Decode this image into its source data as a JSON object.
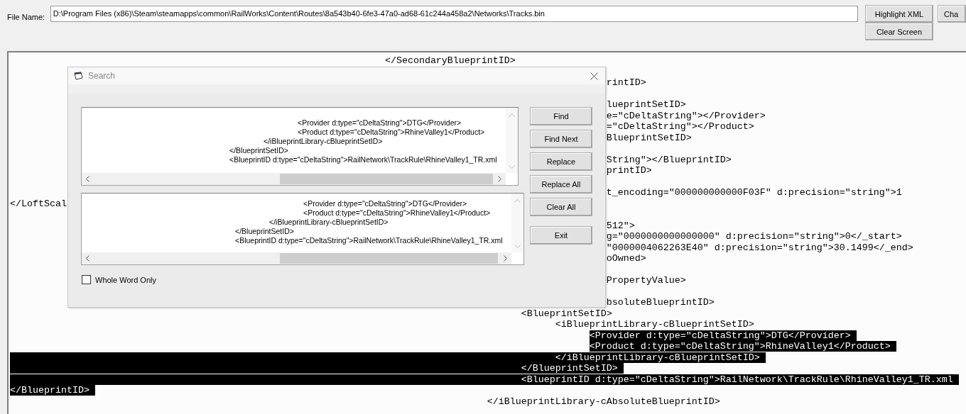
{
  "toolbar": {
    "file_label": "File Name:",
    "file_path": "D:\\Program Files (x86)\\Steam\\steamapps\\common\\RailWorks\\Content\\Routes\\8a543b40-6fe3-47a0-ad68-61c244a458a2\\Networks\\Tracks.bin",
    "buttons": [
      {
        "label": "Highlight XML"
      },
      {
        "label": "Clear Screen"
      }
    ],
    "cut_button": "Cha"
  },
  "editor": {
    "lines": [
      {
        "text": "                                                                  </SecondaryBlueprintID>",
        "selected": false,
        "kind": "inline"
      },
      {
        "selected": false,
        "kind": "inline"
      },
      {
        "text": "                                                                                                         rintID>",
        "selected": false,
        "kind": "inline"
      },
      {
        "selected": false,
        "kind": "inline"
      },
      {
        "text": "                                                                                                         lueprintSetID>",
        "selected": false,
        "kind": "inline"
      },
      {
        "text": "                                                                                                         e=\"cDeltaString\"></Provider>",
        "selected": false,
        "kind": "inline"
      },
      {
        "text": "                                                                                                         =\"cDeltaString\"></Product>",
        "selected": false,
        "kind": "inline"
      },
      {
        "text": "                                                                                                         BlueprintSetID>",
        "selected": false,
        "kind": "inline"
      },
      {
        "selected": false,
        "kind": "inline"
      },
      {
        "text": "                                                                                                         String\"></BlueprintID>",
        "selected": false,
        "kind": "inline"
      },
      {
        "text": "                                                                                                         printID>",
        "selected": false,
        "kind": "inline"
      },
      {
        "selected": false,
        "kind": "inline"
      },
      {
        "text": "                                                                                                         t_encoding=\"000000000000F03F\" d:precision=\"string\">1",
        "selected": false,
        "kind": "inline"
      },
      {
        "text": "</LoftScal",
        "selected": false,
        "kind": "inline"
      },
      {
        "selected": false,
        "kind": "inline"
      },
      {
        "text": "                                                                                                         512\">",
        "selected": false,
        "kind": "inline"
      },
      {
        "text": "                                                                                                         g=\"0000000000000000\" d:precision=\"string\">0</_start>",
        "selected": false,
        "kind": "inline"
      },
      {
        "text": "                                                                                                         \"0000004062263E40\" d:precision=\"string\">30.1499</_end>",
        "selected": false,
        "kind": "inline"
      },
      {
        "text": "                                                                                                         oOwned>",
        "selected": false,
        "kind": "inline"
      },
      {
        "selected": false,
        "kind": "inline"
      },
      {
        "text": "                                                                                                         PropertyValue>",
        "selected": false,
        "kind": "inline"
      },
      {
        "selected": false,
        "kind": "inline"
      },
      {
        "text": "                                                                                                         bsoluteBlueprintID>",
        "selected": false,
        "kind": "inline"
      },
      {
        "text": "                                                                                          <BlueprintSetID>",
        "selected": false,
        "kind": "inline"
      },
      {
        "text": "                                                                                                <iBlueprintLibrary-cBlueprintSetID>",
        "selected": false,
        "kind": "inline"
      },
      {
        "text": "                                                                                                      <Provider d:type=\"cDeltaString\">DTG</Provider>",
        "selected": true,
        "kind": "inline"
      },
      {
        "text": "                                                                                                      <Product d:type=\"cDeltaString\">RhineValley1</Product>",
        "selected": true,
        "kind": "inline"
      },
      {
        "text": "                                                                                                </iBlueprintLibrary-cBlueprintSetID>",
        "selected": true,
        "kind": "full"
      },
      {
        "text": "                                                                                          </BlueprintSetID>",
        "selected": true,
        "kind": "full"
      },
      {
        "text": "                                                                                          <BlueprintID d:type=\"cDeltaString\">RailNetwork\\TrackRule\\RhineValley1_TR.xml",
        "selected": true,
        "kind": "full"
      },
      {
        "text": "</BlueprintID>",
        "selected": true,
        "kind": "full"
      },
      {
        "text": "                                                                                    </iBlueprintLibrary-cAbsoluteBlueprintID>",
        "selected": false,
        "kind": "inline"
      }
    ]
  },
  "search_dialog": {
    "title": "Search",
    "find_box": [
      "\t\t\t\t\t\t<Provider d:type=\"cDeltaString\">DTG</Provider>",
      "\t\t\t\t\t\t<Product d:type=\"cDeltaString\">RhineValley1</Product>",
      "\t\t\t\t\t</iBlueprintLibrary-cBlueprintSetID>",
      "\t\t\t\t</BlueprintSetID>",
      "\t\t\t\t<BlueprintID d:type=\"cDeltaString\">RailNetwork\\TrackRule\\RhineValley1_TR.xml"
    ],
    "replace_box": [
      "\t\t\t\t\t\t<Provider d:type=\"cDeltaString\">DTG</Provider>",
      "\t\t\t\t\t\t<Product d:type=\"cDeltaString\">RhineValley1</Product>",
      "\t\t\t\t\t</iBlueprintLibrary-cBlueprintSetID>",
      "\t\t\t\t</BlueprintSetID>",
      "\t\t\t\t<BlueprintID d:type=\"cDeltaString\">RailNetwork\\TrackRule\\RhineValley1_TR.xml"
    ],
    "button_groups": [
      [
        {
          "label": "Find"
        },
        {
          "label": "Find Next"
        },
        {
          "label": "Replace"
        },
        {
          "label": "Replace All"
        },
        {
          "label": "Clear All"
        }
      ],
      [
        {
          "label": "Exit"
        }
      ]
    ],
    "whole_word": {
      "label": "Whole Word Only",
      "checked": false
    }
  }
}
